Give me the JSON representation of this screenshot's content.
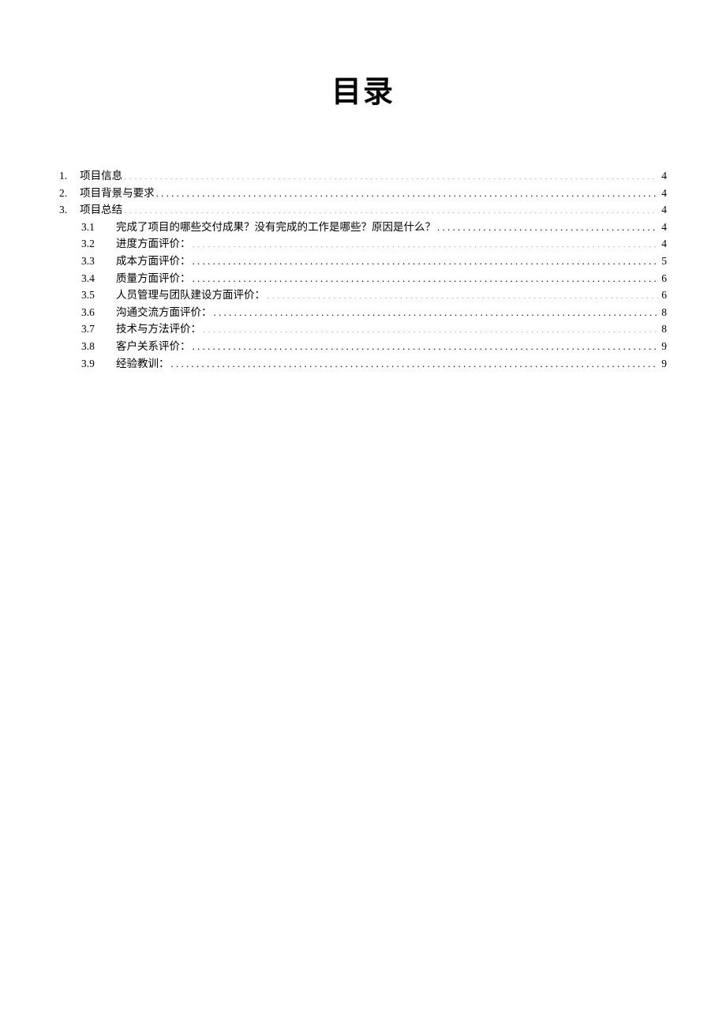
{
  "title": "目录",
  "toc": [
    {
      "level": 1,
      "num": "1.",
      "label": "项目信息",
      "page": "4"
    },
    {
      "level": 1,
      "num": "2.",
      "label": "项目背景与要求",
      "page": "4"
    },
    {
      "level": 1,
      "num": "3.",
      "label": "项目总结",
      "page": "4"
    },
    {
      "level": 2,
      "num": "3.1",
      "label": "完成了项目的哪些交付成果？没有完成的工作是哪些？原因是什么？",
      "page": "4"
    },
    {
      "level": 2,
      "num": "3.2",
      "label": "进度方面评价：",
      "page": "4"
    },
    {
      "level": 2,
      "num": "3.3",
      "label": "成本方面评价：",
      "page": "5"
    },
    {
      "level": 2,
      "num": "3.4",
      "label": "质量方面评价：",
      "page": "6"
    },
    {
      "level": 2,
      "num": "3.5",
      "label": "人员管理与团队建设方面评价：",
      "page": "6"
    },
    {
      "level": 2,
      "num": "3.6",
      "label": "沟通交流方面评价：",
      "page": "8"
    },
    {
      "level": 2,
      "num": "3.7",
      "label": "技术与方法评价：",
      "page": "8"
    },
    {
      "level": 2,
      "num": "3.8",
      "label": "客户关系评价：",
      "page": "9"
    },
    {
      "level": 2,
      "num": "3.9",
      "label": "经验教训：",
      "page": "9"
    }
  ]
}
